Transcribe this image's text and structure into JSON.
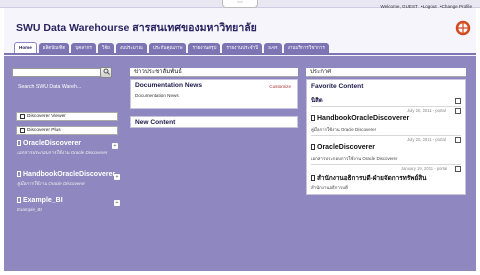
{
  "window": {
    "handle": "⋯"
  },
  "header": {
    "site_title": "SWU Data Warehourse สารสนเทศของมหาวิทยาลัย",
    "top_links": [
      "Welcome, GUEST",
      "•Logout",
      "•Change Profile"
    ]
  },
  "nav": {
    "tabs": [
      "Home",
      "ผลิตบัณฑิต",
      "บุคลากร",
      "วิจัย",
      "งบประมาณ",
      "ประกันคุณภาพ",
      "รายงานสรุป",
      "รายงานประจำปี",
      "SAR",
      "งานบริการวิชาการ"
    ]
  },
  "left": {
    "search_link": "Search SWU Data Wareh...",
    "buttons": [
      "Discoverer Viewer",
      "Discoverer Plus"
    ],
    "items": [
      {
        "title": "OracleDiscoverer",
        "sub": "เอกสารประกอบการใช้งาน Oracle Discoverer"
      },
      {
        "title": "HandbookOracleDiscoverer",
        "sub": "คู่มือการใช้งาน Oracle Discoverer"
      },
      {
        "title": "Example_BI",
        "sub": "Example_BI"
      }
    ]
  },
  "middle": {
    "section_title": "ข่าวประชาสัมพันธ์",
    "doc_news_title": "Documentation News",
    "doc_news_sub": "Documentation News",
    "customize": "Customize",
    "new_content": "New Content"
  },
  "right": {
    "section_title": "ประกาศ",
    "fav_title": "Favorite Content",
    "fav_sub": "นิสิต",
    "items": [
      {
        "meta": "July 20, 2011 - portal",
        "title": "HandbookOracleDiscoverer",
        "sub": "คู่มือการใช้งาน Oracle Discoverer"
      },
      {
        "meta": "July 20, 2011 - portal",
        "title": "OracleDiscoverer",
        "sub": "เอกสารประกอบการใช้งาน Oracle Discoverer"
      },
      {
        "meta": "January 19, 2011 - portal",
        "title": "สำนักงานอธิการบดี-ฝ่ายจัดการทรัพย์สิน",
        "sub": "สำนักงานอธิการบดี"
      }
    ]
  },
  "colors": {
    "accent": "#7d74b4",
    "background": "#8f88c0",
    "title": "#2a2260",
    "logo": "#d24a1e"
  }
}
